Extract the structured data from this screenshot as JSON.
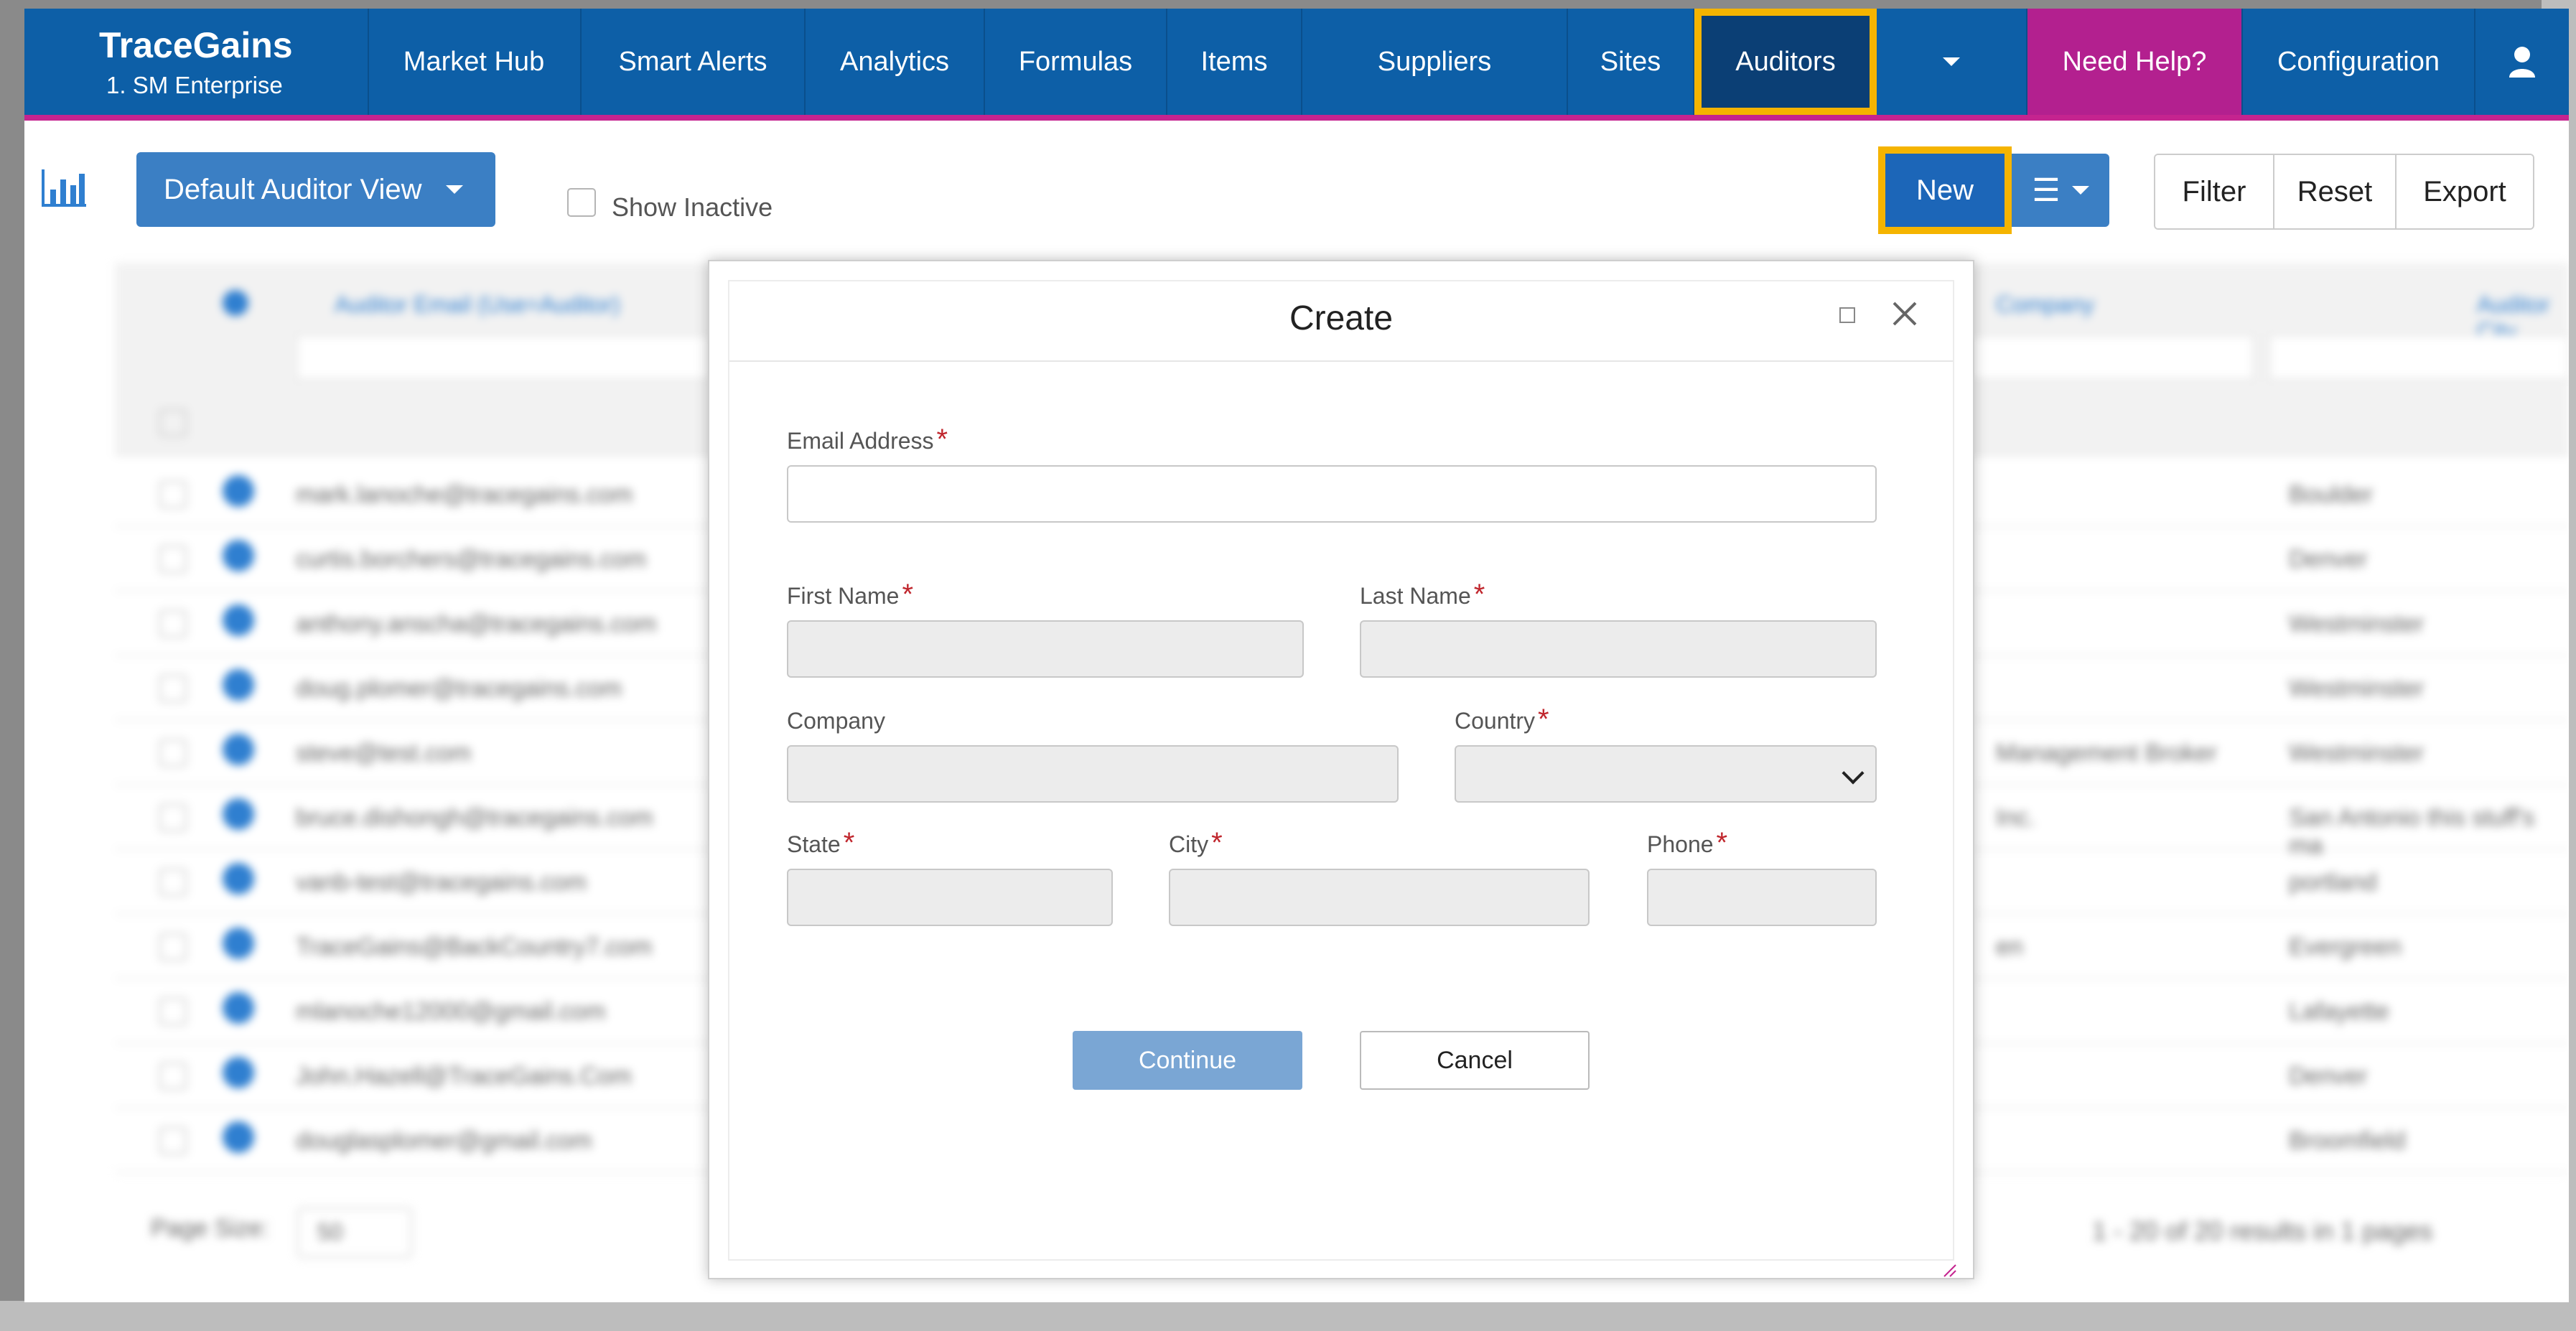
{
  "brand": {
    "name": "TraceGains",
    "subtitle": "1. SM Enterprise"
  },
  "nav": {
    "items": [
      "Market Hub",
      "Smart Alerts",
      "Analytics",
      "Formulas",
      "Items",
      "Suppliers",
      "Sites",
      "Auditors"
    ],
    "help": "Need Help?",
    "configuration": "Configuration"
  },
  "toolbar": {
    "view_label": "Default Auditor View",
    "show_inactive": "Show Inactive",
    "new_label": "New",
    "filter_label": "Filter",
    "reset_label": "Reset",
    "export_label": "Export"
  },
  "grid": {
    "columns": [
      "Auditor Email (Use=Auditor)",
      "Company",
      "Auditor City"
    ],
    "rows": [
      {
        "email": "mark.lanoche@tracegains.com",
        "company": "",
        "city": "Boulder"
      },
      {
        "email": "curtis.borchers@tracegains.com",
        "company": "",
        "city": "Denver"
      },
      {
        "email": "anthony.anscha@tracegains.com",
        "company": "",
        "city": "Westminster"
      },
      {
        "email": "doug.plomer@tracegains.com",
        "company": "",
        "city": "Westminster"
      },
      {
        "email": "steve@test.com",
        "company": "Management Broker",
        "city": "Westminster"
      },
      {
        "email": "bruce.dishongh@tracegains.com",
        "company": "Inc.",
        "city": "San Antonio this stuff's ma"
      },
      {
        "email": "vanb-test@tracegains.com",
        "company": "",
        "city": "portland"
      },
      {
        "email": "TraceGains@BackCountry7.com",
        "company": "en",
        "city": "Evergreen"
      },
      {
        "email": "mlanoche12000@gmail.com",
        "company": "",
        "city": "Lafayette"
      },
      {
        "email": "John.Hazell@TraceGains.Com",
        "company": "",
        "city": "Denver"
      },
      {
        "email": "douglasplomer@gmail.com",
        "company": "",
        "city": "Broomfield"
      }
    ],
    "page_size_label": "Page Size:",
    "page_size": "50",
    "results": "1 - 20 of 20 results in 1 pages"
  },
  "modal": {
    "title": "Create",
    "labels": {
      "email": "Email Address",
      "first_name": "First Name",
      "last_name": "Last Name",
      "company": "Company",
      "country": "Country",
      "state": "State",
      "city": "City",
      "phone": "Phone"
    },
    "required_mark": "*",
    "continue_label": "Continue",
    "cancel_label": "Cancel"
  },
  "colors": {
    "nav_bg": "#0d5fa7",
    "nav_accent": "#c5248f",
    "highlight": "#f5b400",
    "primary": "#3b7fc4"
  }
}
